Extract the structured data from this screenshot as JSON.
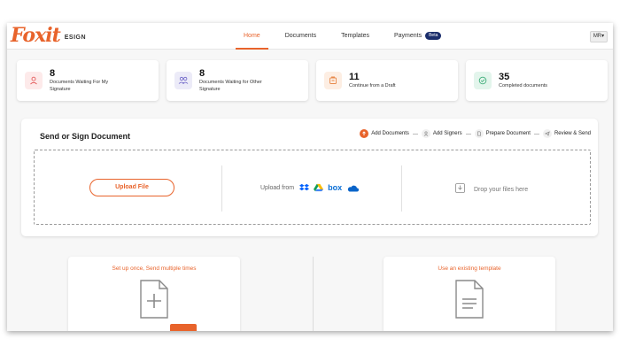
{
  "brand": {
    "logo_text": "Foxit",
    "product": "ESIGN",
    "accent": "#e8632b"
  },
  "nav": {
    "items": [
      {
        "label": "Home",
        "active": true
      },
      {
        "label": "Documents",
        "active": false
      },
      {
        "label": "Templates",
        "active": false
      },
      {
        "label": "Payments",
        "active": false,
        "badge": "Beta"
      }
    ]
  },
  "user": {
    "initials": "MR",
    "icon": "caret-down-icon"
  },
  "stats": [
    {
      "count": "8",
      "label": "Documents Waiting For My Signature",
      "icon": "user-icon",
      "color": "#e45b5b",
      "bg": "#fdeaea"
    },
    {
      "count": "8",
      "label": "Documents Waiting for Other Signature",
      "icon": "users-icon",
      "color": "#6c63c7",
      "bg": "#ecebf8"
    },
    {
      "count": "11",
      "label": "Continue from a Draft",
      "icon": "draft-icon",
      "color": "#e8894a",
      "bg": "#fdeee3"
    },
    {
      "count": "35",
      "label": "Completed documents",
      "icon": "check-circle-icon",
      "color": "#3fae7a",
      "bg": "#e3f5ec"
    }
  ],
  "send": {
    "title": "Send or Sign Document",
    "steps": [
      {
        "label": "Add Documents",
        "icon": "upload-icon",
        "active": true
      },
      {
        "label": "Add Signers",
        "icon": "user-icon",
        "active": false
      },
      {
        "label": "Prepare Document",
        "icon": "document-icon",
        "active": false
      },
      {
        "label": "Review & Send",
        "icon": "send-icon",
        "active": false
      }
    ],
    "upload_button": "Upload File",
    "upload_from_label": "Upload from",
    "sources": [
      "dropbox-icon",
      "google-drive-icon",
      "box",
      "onedrive-icon"
    ],
    "box_label": "box",
    "drop_label": "Drop your files here"
  },
  "templates": [
    {
      "title": "Set up once, Send multiple times",
      "icon": "new-document-icon"
    },
    {
      "title": "Use an existing template",
      "icon": "document-lines-icon"
    }
  ]
}
